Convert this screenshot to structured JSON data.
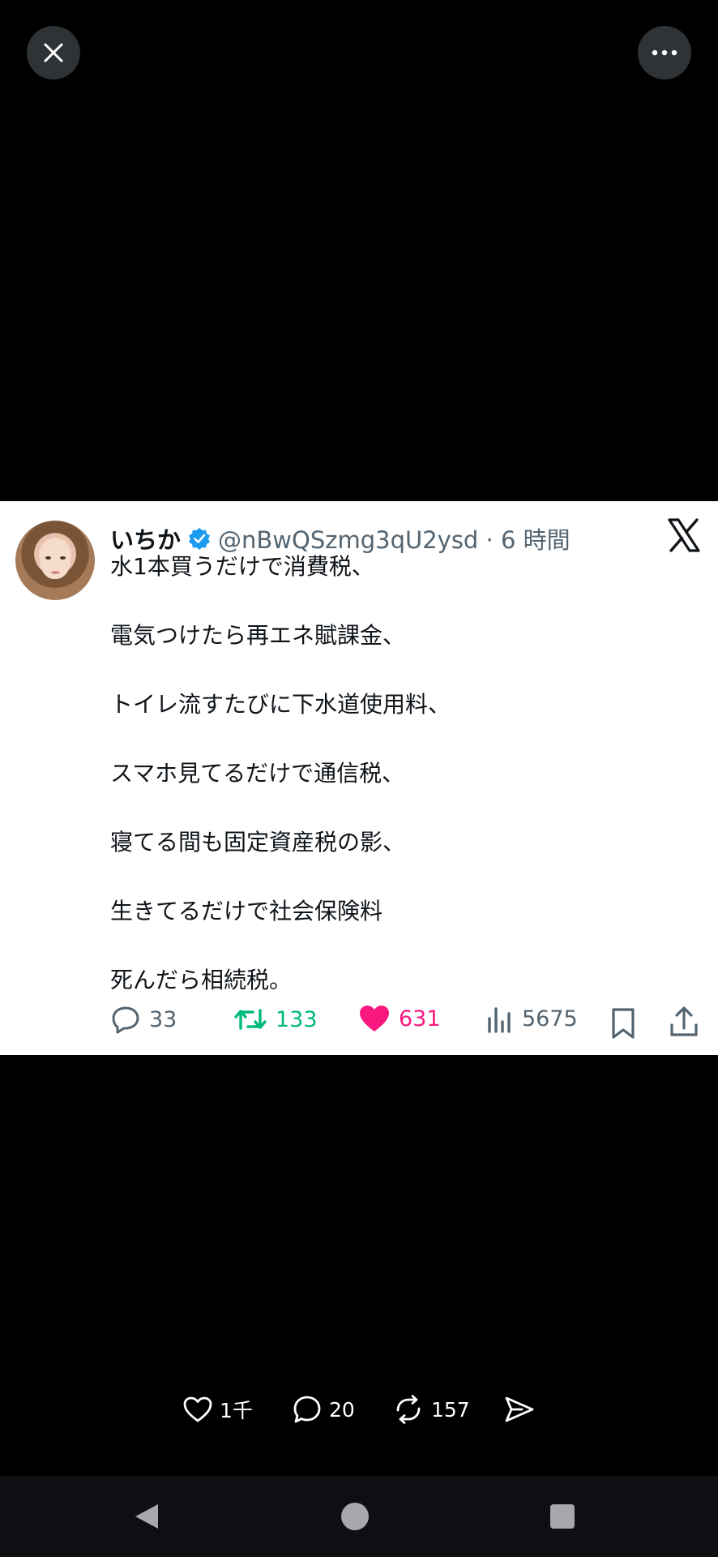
{
  "tweet": {
    "display_name": "いちか",
    "handle_time": "@nBwQSzmg3qU2ysd · 6 時間",
    "lines": [
      "水1本買うだけで消費税、",
      "電気つけたら再エネ賦課金、",
      "トイレ流すたびに下水道使用料、",
      "スマホ見てるだけで通信税、",
      "寝てる間も固定資産税の影、",
      "生きてるだけで社会保険料",
      "死んだら相続税。"
    ],
    "stats": {
      "replies": "33",
      "retweets": "133",
      "likes": "631",
      "views": "5675"
    },
    "colors": {
      "retweet": "#00ba7c",
      "like": "#f91880",
      "verified": "#1d9bf0"
    }
  },
  "post": {
    "likes": "1千",
    "comments": "20",
    "reposts": "157"
  }
}
